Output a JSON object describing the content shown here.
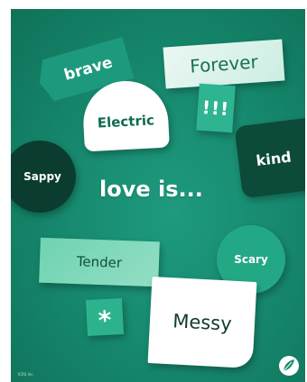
{
  "poster": {
    "headline": "love is...",
    "words": {
      "brave": "brave",
      "forever": "Forever",
      "electric": "Electric",
      "exclaim": "!!!",
      "kind": "kind",
      "sappy": "Sappy",
      "tender": "Tender",
      "scary": "Scary",
      "asterisk": "*",
      "messy": "Messy"
    },
    "footer": "ICRS Inc.",
    "logo_icon": "leaf-logo-icon",
    "colors": {
      "background": "#178a6f",
      "dark_shape": "#0a3d30",
      "bright_shape": "#23a886",
      "text_light": "#ffffff"
    }
  }
}
